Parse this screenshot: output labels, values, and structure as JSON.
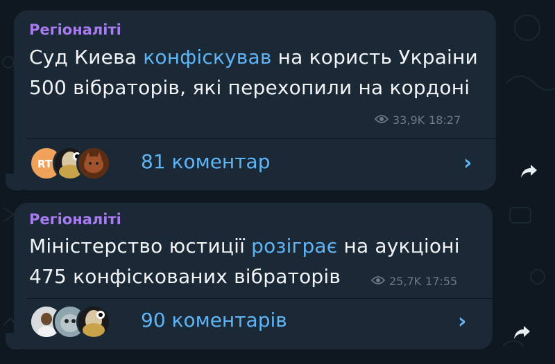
{
  "messages": [
    {
      "channel": "Регіоналіті",
      "text_before": "Суд Киeва ",
      "text_highlight": "конфіскував",
      "text_after": " на користь Украiни 500 вібраторів, які перехопили на кордоні",
      "views": "33,9K",
      "time": "18:27",
      "comments_label": "81 коментар",
      "avatar_initials": "RT"
    },
    {
      "channel": "Регіоналіті",
      "text_before": "Міністерство юстиції ",
      "text_highlight": "розіграє",
      "text_after": " на аукціоні 475 конфіскованих вібраторів",
      "views": "25,7K",
      "time": "17:55",
      "comments_label": "90 коментарів"
    }
  ],
  "icons": {
    "views": "eye-icon",
    "comments_arrow": "chevron-right-icon",
    "share": "share-arrow-icon"
  },
  "colors": {
    "background": "#0f1821",
    "bubble": "#1b2835",
    "channel_name": "#a87bf1",
    "link": "#5eb5f7",
    "text": "#f1f3f5",
    "meta": "#6c7a88"
  }
}
